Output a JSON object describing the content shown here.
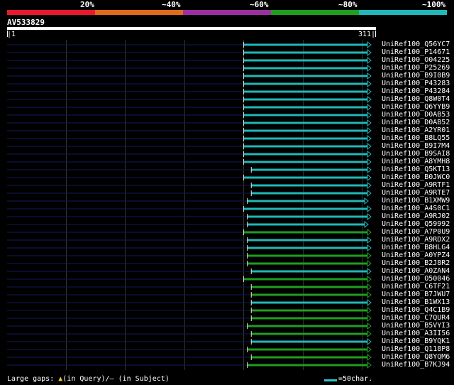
{
  "legend": {
    "labels": [
      "20%",
      "~40%",
      "~60%",
      "~80%",
      "~100%"
    ],
    "colors": [
      "#e8192c",
      "#e06b1a",
      "#9b2fa0",
      "#1f9e1f",
      "#20b8b8"
    ]
  },
  "query": {
    "title": "AV533829",
    "start": "|1",
    "end": "311|"
  },
  "hits": [
    {
      "id": "UniRef100_Q56YC7",
      "color": "#20b8b8",
      "from": 0.654,
      "arrow": "open"
    },
    {
      "id": "UniRef100_P14671",
      "color": "#20b8b8",
      "from": 0.654,
      "arrow": "open"
    },
    {
      "id": "UniRef100_O04225",
      "color": "#20b8b8",
      "from": 0.654,
      "arrow": "open"
    },
    {
      "id": "UniRef100_P25269",
      "color": "#20b8b8",
      "from": 0.654,
      "arrow": "open"
    },
    {
      "id": "UniRef100_B9I0B9",
      "color": "#20b8b8",
      "from": 0.654,
      "arrow": "open"
    },
    {
      "id": "UniRef100_P43283",
      "color": "#20b8b8",
      "from": 0.654,
      "arrow": "open"
    },
    {
      "id": "UniRef100_P43284",
      "color": "#20b8b8",
      "from": 0.654,
      "arrow": "open"
    },
    {
      "id": "UniRef100_Q8W0T4",
      "color": "#20b8b8",
      "from": 0.654,
      "arrow": "open"
    },
    {
      "id": "UniRef100_Q6YYB9",
      "color": "#20b8b8",
      "from": 0.654,
      "arrow": "open"
    },
    {
      "id": "UniRef100_D0AB53",
      "color": "#20b8b8",
      "from": 0.654,
      "arrow": "open"
    },
    {
      "id": "UniRef100_D0AB52",
      "color": "#20b8b8",
      "from": 0.654,
      "arrow": "open"
    },
    {
      "id": "UniRef100_A2YR01",
      "color": "#20b8b8",
      "from": 0.654,
      "arrow": "open"
    },
    {
      "id": "UniRef100_B8LQ55",
      "color": "#20b8b8",
      "from": 0.654,
      "arrow": "open"
    },
    {
      "id": "UniRef100_B9I7M4",
      "color": "#20b8b8",
      "from": 0.654,
      "arrow": "open"
    },
    {
      "id": "UniRef100_B9SAI8",
      "color": "#20b8b8",
      "from": 0.654,
      "arrow": "open"
    },
    {
      "id": "UniRef100_A8YMH8",
      "color": "#20b8b8",
      "from": 0.654,
      "arrow": "open"
    },
    {
      "id": "UniRef100_Q5KT13",
      "color": "#20b8b8",
      "from": 0.675,
      "arrow": "open"
    },
    {
      "id": "UniRef100_B0JWC0",
      "color": "#20b8b8",
      "from": 0.654,
      "arrow": "open"
    },
    {
      "id": "UniRef100_A9RTF1",
      "color": "#20b8b8",
      "from": 0.675,
      "arrow": "open"
    },
    {
      "id": "UniRef100_A9RTE7",
      "color": "#20b8b8",
      "from": 0.675,
      "arrow": "open"
    },
    {
      "id": "UniRef100_B1XMW9",
      "color": "#20b8b8",
      "from": 0.664,
      "arrow": "short"
    },
    {
      "id": "UniRef100_A4S0C1",
      "color": "#20b8b8",
      "from": 0.654,
      "arrow": "open"
    },
    {
      "id": "UniRef100_A9RJ02",
      "color": "#20b8b8",
      "from": 0.664,
      "arrow": "open"
    },
    {
      "id": "UniRef100_Q59992",
      "color": "#20b8b8",
      "from": 0.664,
      "arrow": "short"
    },
    {
      "id": "UniRef100_A7P0U9",
      "color": "#1f9e1f",
      "from": 0.654,
      "arrow": "open"
    },
    {
      "id": "UniRef100_A9RDX2",
      "color": "#20b8b8",
      "from": 0.664,
      "arrow": "open"
    },
    {
      "id": "UniRef100_B8HLG4",
      "color": "#20b8b8",
      "from": 0.664,
      "arrow": "open"
    },
    {
      "id": "UniRef100_A0YPZ4",
      "color": "#1f9e1f",
      "from": 0.664,
      "arrow": "open"
    },
    {
      "id": "UniRef100_B2J8R2",
      "color": "#1f9e1f",
      "from": 0.664,
      "arrow": "open"
    },
    {
      "id": "UniRef100_A0ZAN4",
      "color": "#20b8b8",
      "from": 0.675,
      "arrow": "open"
    },
    {
      "id": "UniRef100_O50046",
      "color": "#1f9e1f",
      "from": 0.654,
      "arrow": "open"
    },
    {
      "id": "UniRef100_C6TF21",
      "color": "#1f9e1f",
      "from": 0.675,
      "arrow": "open"
    },
    {
      "id": "UniRef100_B7JWU7",
      "color": "#1f9e1f",
      "from": 0.675,
      "arrow": "open"
    },
    {
      "id": "UniRef100_B1WX13",
      "color": "#20b8b8",
      "from": 0.675,
      "arrow": "open"
    },
    {
      "id": "UniRef100_Q4C1B9",
      "color": "#1f9e1f",
      "from": 0.675,
      "arrow": "open"
    },
    {
      "id": "UniRef100_C7QUR4",
      "color": "#1f9e1f",
      "from": 0.675,
      "arrow": "open"
    },
    {
      "id": "UniRef100_B5VYI3",
      "color": "#1f9e1f",
      "from": 0.664,
      "arrow": "open"
    },
    {
      "id": "UniRef100_A3II56",
      "color": "#1f9e1f",
      "from": 0.675,
      "arrow": "open"
    },
    {
      "id": "UniRef100_B9YQK1",
      "color": "#20b8b8",
      "from": 0.675,
      "arrow": "open"
    },
    {
      "id": "UniRef100_Q118P8",
      "color": "#1f9e1f",
      "from": 0.664,
      "arrow": "open"
    },
    {
      "id": "UniRef100_Q8YQM6",
      "color": "#1f9e1f",
      "from": 0.675,
      "arrow": "open"
    },
    {
      "id": "UniRef100_B7KJ94",
      "color": "#1f9e1f",
      "from": 0.664,
      "arrow": "open"
    }
  ],
  "footer": {
    "gaps_label": "Large gaps: ",
    "gaps_query_glyph": "▲",
    "gaps_query": "(in Query)/",
    "gaps_subject_glyph": "–",
    "gaps_subject": " (in Subject)",
    "scale_label": "=50char."
  }
}
